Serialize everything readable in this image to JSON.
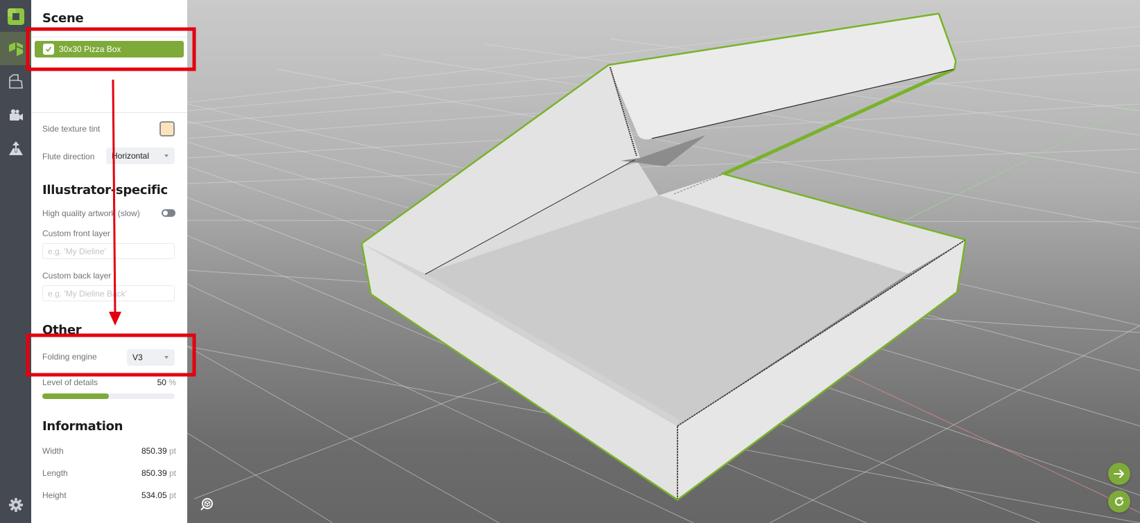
{
  "rail": {
    "items": [
      {
        "icon": "app-logo-icon",
        "active": false
      },
      {
        "icon": "box-3d-icon",
        "active": true
      },
      {
        "icon": "dieline-icon",
        "active": false
      },
      {
        "icon": "video-camera-icon",
        "active": false
      },
      {
        "icon": "export-upload-icon",
        "active": false
      }
    ],
    "bottom_icon": "settings-gear-icon"
  },
  "panel": {
    "scene": {
      "title": "Scene",
      "item": {
        "label": "30x30 Pizza Box",
        "checked": true
      }
    },
    "side_texture_tint": {
      "label": "Side texture tint",
      "color": "#fde3bb"
    },
    "flute_direction": {
      "label": "Flute direction",
      "value": "Horizontal"
    },
    "illustrator": {
      "title": "Illustrator-specific",
      "high_quality_label": "High quality artwork (slow)",
      "high_quality_on": false,
      "front_layer_label": "Custom front layer",
      "front_layer_placeholder": "e.g. 'My Dieline'",
      "back_layer_label": "Custom back layer",
      "back_layer_placeholder": "e.g. 'My Dieline Back'"
    },
    "other": {
      "title": "Other",
      "folding_engine_label": "Folding engine",
      "folding_engine_value": "V3",
      "level_of_details_label": "Level of details",
      "level_of_details_value": "50",
      "level_of_details_unit": "%",
      "level_of_details_fraction": 0.5
    },
    "information": {
      "title": "Information",
      "rows": [
        {
          "label": "Width",
          "value": "850.39",
          "unit": "pt"
        },
        {
          "label": "Length",
          "value": "850.39",
          "unit": "pt"
        },
        {
          "label": "Height",
          "value": "534.05",
          "unit": "pt"
        }
      ]
    }
  },
  "viewport": {
    "buttons": [
      {
        "name": "next-arrow-icon"
      },
      {
        "name": "refresh-icon"
      }
    ],
    "nav_icon": "view-cube-icon"
  },
  "colors": {
    "accent": "#7eaa3a",
    "selection_outline": "#79b22a",
    "annotation": "#e3000f"
  }
}
